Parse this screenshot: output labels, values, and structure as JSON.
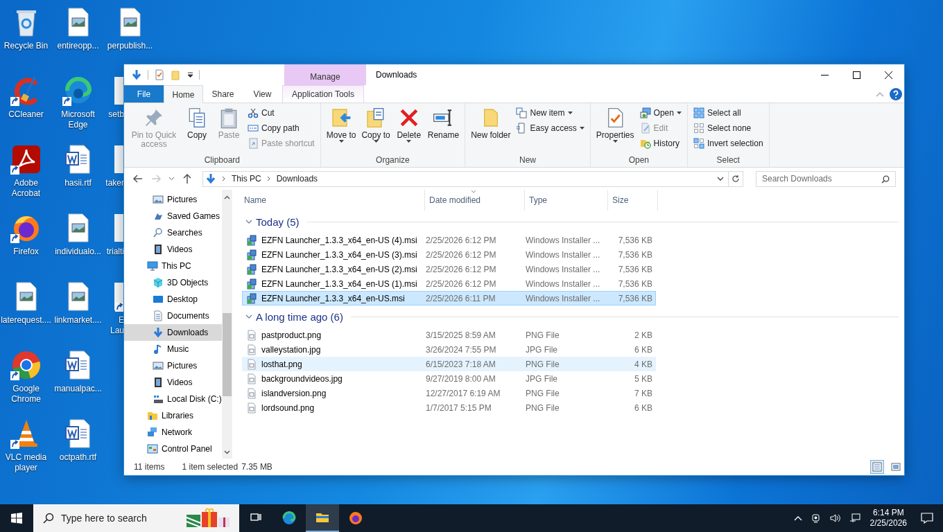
{
  "desktop_icons": [
    {
      "label": "Recycle Bin",
      "kind": "recycle",
      "shortcut": false
    },
    {
      "label": "CCleaner",
      "kind": "ccleaner",
      "shortcut": true
    },
    {
      "label": "Adobe Acrobat",
      "kind": "acrobat",
      "shortcut": true
    },
    {
      "label": "Firefox",
      "kind": "firefox",
      "shortcut": true
    },
    {
      "label": "laterequest....",
      "kind": "image",
      "shortcut": false
    },
    {
      "label": "Google Chrome",
      "kind": "chrome",
      "shortcut": true
    },
    {
      "label": "VLC media player",
      "kind": "vlc",
      "shortcut": true
    },
    {
      "label": "entireopp...",
      "kind": "image",
      "shortcut": false
    },
    {
      "label": "Microsoft Edge",
      "kind": "edge",
      "shortcut": true
    },
    {
      "label": "hasii.rtf",
      "kind": "word",
      "shortcut": false
    },
    {
      "label": "individualo...",
      "kind": "image",
      "shortcut": false
    },
    {
      "label": "linkmarket....",
      "kind": "image",
      "shortcut": false
    },
    {
      "label": "manualpac...",
      "kind": "word",
      "shortcut": false
    },
    {
      "label": "octpath.rtf",
      "kind": "word",
      "shortcut": false
    },
    {
      "label": "perpublish...",
      "kind": "image",
      "shortcut": false
    },
    {
      "label": "setb",
      "kind": "partial",
      "shortcut": false
    },
    {
      "label": "taker",
      "kind": "partial",
      "shortcut": false
    },
    {
      "label": "trialti",
      "kind": "partial",
      "shortcut": false
    },
    {
      "label": "E Lau",
      "kind": "partial",
      "shortcut": true
    }
  ],
  "explorer": {
    "title": "Downloads",
    "tabs": [
      {
        "label": "File",
        "kind": "file",
        "selected": false
      },
      {
        "label": "Home",
        "kind": "tab",
        "selected": true
      },
      {
        "label": "Share",
        "kind": "tab",
        "selected": false
      },
      {
        "label": "View",
        "kind": "tab",
        "selected": false
      },
      {
        "label": "Application Tools",
        "kind": "contextual",
        "context": "Manage",
        "selected": false
      }
    ],
    "ribbon_groups": [
      {
        "label": "Clipboard",
        "commands": [
          {
            "label": "Pin to Quick access",
            "kind": "large",
            "disabled": true,
            "dropdown": false
          },
          {
            "label": "Copy",
            "kind": "large",
            "disabled": false,
            "dropdown": false
          },
          {
            "label": "Paste",
            "kind": "large",
            "disabled": true,
            "dropdown": false
          },
          {
            "label": "Cut",
            "kind": "small",
            "disabled": false,
            "dropdown": false
          },
          {
            "label": "Copy path",
            "kind": "small",
            "disabled": false,
            "dropdown": false
          },
          {
            "label": "Paste shortcut",
            "kind": "small",
            "disabled": true,
            "dropdown": false
          }
        ]
      },
      {
        "label": "Organize",
        "commands": [
          {
            "label": "Move to",
            "kind": "large",
            "disabled": false,
            "dropdown": true
          },
          {
            "label": "Copy to",
            "kind": "large",
            "disabled": false,
            "dropdown": true
          },
          {
            "label": "Delete",
            "kind": "large",
            "disabled": false,
            "dropdown": true
          },
          {
            "label": "Rename",
            "kind": "large",
            "disabled": false,
            "dropdown": false
          }
        ]
      },
      {
        "label": "New",
        "commands": [
          {
            "label": "New folder",
            "kind": "large",
            "disabled": false,
            "dropdown": false
          },
          {
            "label": "New item",
            "kind": "small",
            "disabled": false,
            "dropdown": true
          },
          {
            "label": "Easy access",
            "kind": "small",
            "disabled": false,
            "dropdown": true
          }
        ]
      },
      {
        "label": "Open",
        "commands": [
          {
            "label": "Properties",
            "kind": "large",
            "disabled": false,
            "dropdown": true
          },
          {
            "label": "Open",
            "kind": "small",
            "disabled": false,
            "dropdown": true
          },
          {
            "label": "Edit",
            "kind": "small",
            "disabled": true,
            "dropdown": false
          },
          {
            "label": "History",
            "kind": "small",
            "disabled": false,
            "dropdown": false
          }
        ]
      },
      {
        "label": "Select",
        "commands": [
          {
            "label": "Select all",
            "kind": "small",
            "disabled": false,
            "dropdown": false
          },
          {
            "label": "Select none",
            "kind": "small",
            "disabled": false,
            "dropdown": false
          },
          {
            "label": "Invert selection",
            "kind": "small",
            "disabled": false,
            "dropdown": false
          }
        ]
      }
    ],
    "back": {
      "disabled": false
    },
    "forward": {
      "disabled": true
    },
    "crumbs": [
      "This PC",
      "Downloads"
    ],
    "search": {
      "placeholder": "Search Downloads"
    },
    "nav_items": [
      {
        "children": [
          {
            "label": "Pictures",
            "selected": false
          },
          {
            "label": "Saved Games",
            "selected": false
          },
          {
            "label": "Searches",
            "selected": false
          },
          {
            "label": "Videos",
            "selected": false
          }
        ]
      },
      {
        "label": "This PC",
        "selected": false,
        "children": [
          {
            "label": "3D Objects",
            "selected": false
          },
          {
            "label": "Desktop",
            "selected": false
          },
          {
            "label": "Documents",
            "selected": false
          },
          {
            "label": "Downloads",
            "selected": true
          },
          {
            "label": "Music",
            "selected": false
          },
          {
            "label": "Pictures",
            "selected": false
          },
          {
            "label": "Videos",
            "selected": false
          },
          {
            "label": "Local Disk (C:)",
            "selected": false
          }
        ]
      },
      {
        "label": "Libraries",
        "selected": false
      },
      {
        "label": "Network",
        "selected": false
      },
      {
        "label": "Control Panel",
        "selected": false
      }
    ],
    "columns": [
      {
        "label": "Name",
        "sorted": false
      },
      {
        "label": "Date modified",
        "sorted": true
      },
      {
        "label": "Type",
        "sorted": false
      },
      {
        "label": "Size",
        "sorted": false
      }
    ],
    "groups": [
      {
        "label": "Today (5)",
        "rows": [
          {
            "name": "EZFN Launcher_1.3.3_x64_en-US (4).msi",
            "date": "2/25/2026 6:12 PM",
            "type": "Windows Installer ...",
            "size": "7,536 KB",
            "kind": "installer",
            "selected": false,
            "hovered": false
          },
          {
            "name": "EZFN Launcher_1.3.3_x64_en-US (3).msi",
            "date": "2/25/2026 6:12 PM",
            "type": "Windows Installer ...",
            "size": "7,536 KB",
            "kind": "installer",
            "selected": false,
            "hovered": false
          },
          {
            "name": "EZFN Launcher_1.3.3_x64_en-US (2).msi",
            "date": "2/25/2026 6:12 PM",
            "type": "Windows Installer ...",
            "size": "7,536 KB",
            "kind": "installer",
            "selected": false,
            "hovered": false
          },
          {
            "name": "EZFN Launcher_1.3.3_x64_en-US (1).msi",
            "date": "2/25/2026 6:12 PM",
            "type": "Windows Installer ...",
            "size": "7,536 KB",
            "kind": "installer",
            "selected": false,
            "hovered": false
          },
          {
            "name": "EZFN Launcher_1.3.3_x64_en-US.msi",
            "date": "2/25/2026 6:11 PM",
            "type": "Windows Installer ...",
            "size": "7,536 KB",
            "kind": "installer",
            "selected": true,
            "hovered": false
          }
        ]
      },
      {
        "label": "A long time ago (6)",
        "rows": [
          {
            "name": "pastproduct.png",
            "date": "3/15/2025 8:59 AM",
            "type": "PNG File",
            "size": "2 KB",
            "kind": "file",
            "selected": false,
            "hovered": false
          },
          {
            "name": "valleystation.jpg",
            "date": "3/26/2024 7:55 PM",
            "type": "JPG File",
            "size": "6 KB",
            "kind": "file",
            "selected": false,
            "hovered": false
          },
          {
            "name": "losthat.png",
            "date": "6/15/2023 7:18 AM",
            "type": "PNG File",
            "size": "4 KB",
            "kind": "file",
            "selected": false,
            "hovered": true
          },
          {
            "name": "backgroundvideos.jpg",
            "date": "9/27/2019 8:00 AM",
            "type": "JPG File",
            "size": "5 KB",
            "kind": "file",
            "selected": false,
            "hovered": false
          },
          {
            "name": "islandversion.png",
            "date": "12/27/2017 6:19 AM",
            "type": "PNG File",
            "size": "7 KB",
            "kind": "file",
            "selected": false,
            "hovered": false
          },
          {
            "name": "lordsound.png",
            "date": "1/7/2017 5:15 PM",
            "type": "PNG File",
            "size": "6 KB",
            "kind": "file",
            "selected": false,
            "hovered": false
          }
        ]
      }
    ],
    "status": {
      "count": "11 items",
      "selection": "1 item selected",
      "size": "7.35 MB"
    },
    "view_buttons": [
      {
        "selected": true
      },
      {
        "selected": false
      }
    ]
  },
  "taskbar": {
    "search_placeholder": "Type here to search",
    "apps": [
      {
        "active": false
      },
      {
        "active": false
      },
      {
        "active": true
      },
      {
        "active": false
      }
    ],
    "time": "6:14 PM",
    "date": "2/25/2026"
  }
}
